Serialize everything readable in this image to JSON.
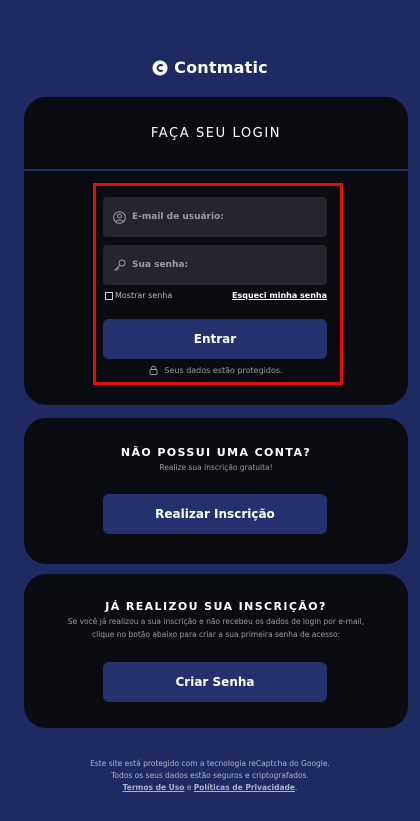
{
  "brand": {
    "name": "Contmatic",
    "logo_icon": "contmatic-logo-icon"
  },
  "login": {
    "title": "FAÇA SEU LOGIN",
    "email_placeholder": "E-mail de usuário:",
    "password_placeholder": "Sua senha:",
    "show_password_label": "Mostrar senha",
    "forgot_password_label": "Esqueci minha senha",
    "enter_button": "Entrar",
    "protected_note": "Seus dados estão protegidos."
  },
  "signup": {
    "title": "NÃO POSSUI UMA CONTA?",
    "subtitle": "Realize sua inscrição gratuita!",
    "button": "Realizar Inscrição"
  },
  "create_password": {
    "title": "JÁ REALIZOU SUA INSCRIÇÃO?",
    "subtitle_line1": "Se você já realizou a sua inscrição e não recebeu os dados de login por e-mail,",
    "subtitle_line2": "clique no botão abaixo para criar a sua primeira senha de acesso:",
    "button": "Criar Senha"
  },
  "footer": {
    "line1": "Este site está protegido com a tecnologia reCaptcha do Google.",
    "line2": "Todos os seus dados estão seguros e criptografados.",
    "terms_link": "Termos de Uso",
    "and": "e",
    "privacy_link": "Políticas de Privacidade"
  },
  "colors": {
    "background": "#1f2a63",
    "card": "#0b0c12",
    "button": "#25316e",
    "input": "#25262d",
    "highlight": "#e01010"
  }
}
